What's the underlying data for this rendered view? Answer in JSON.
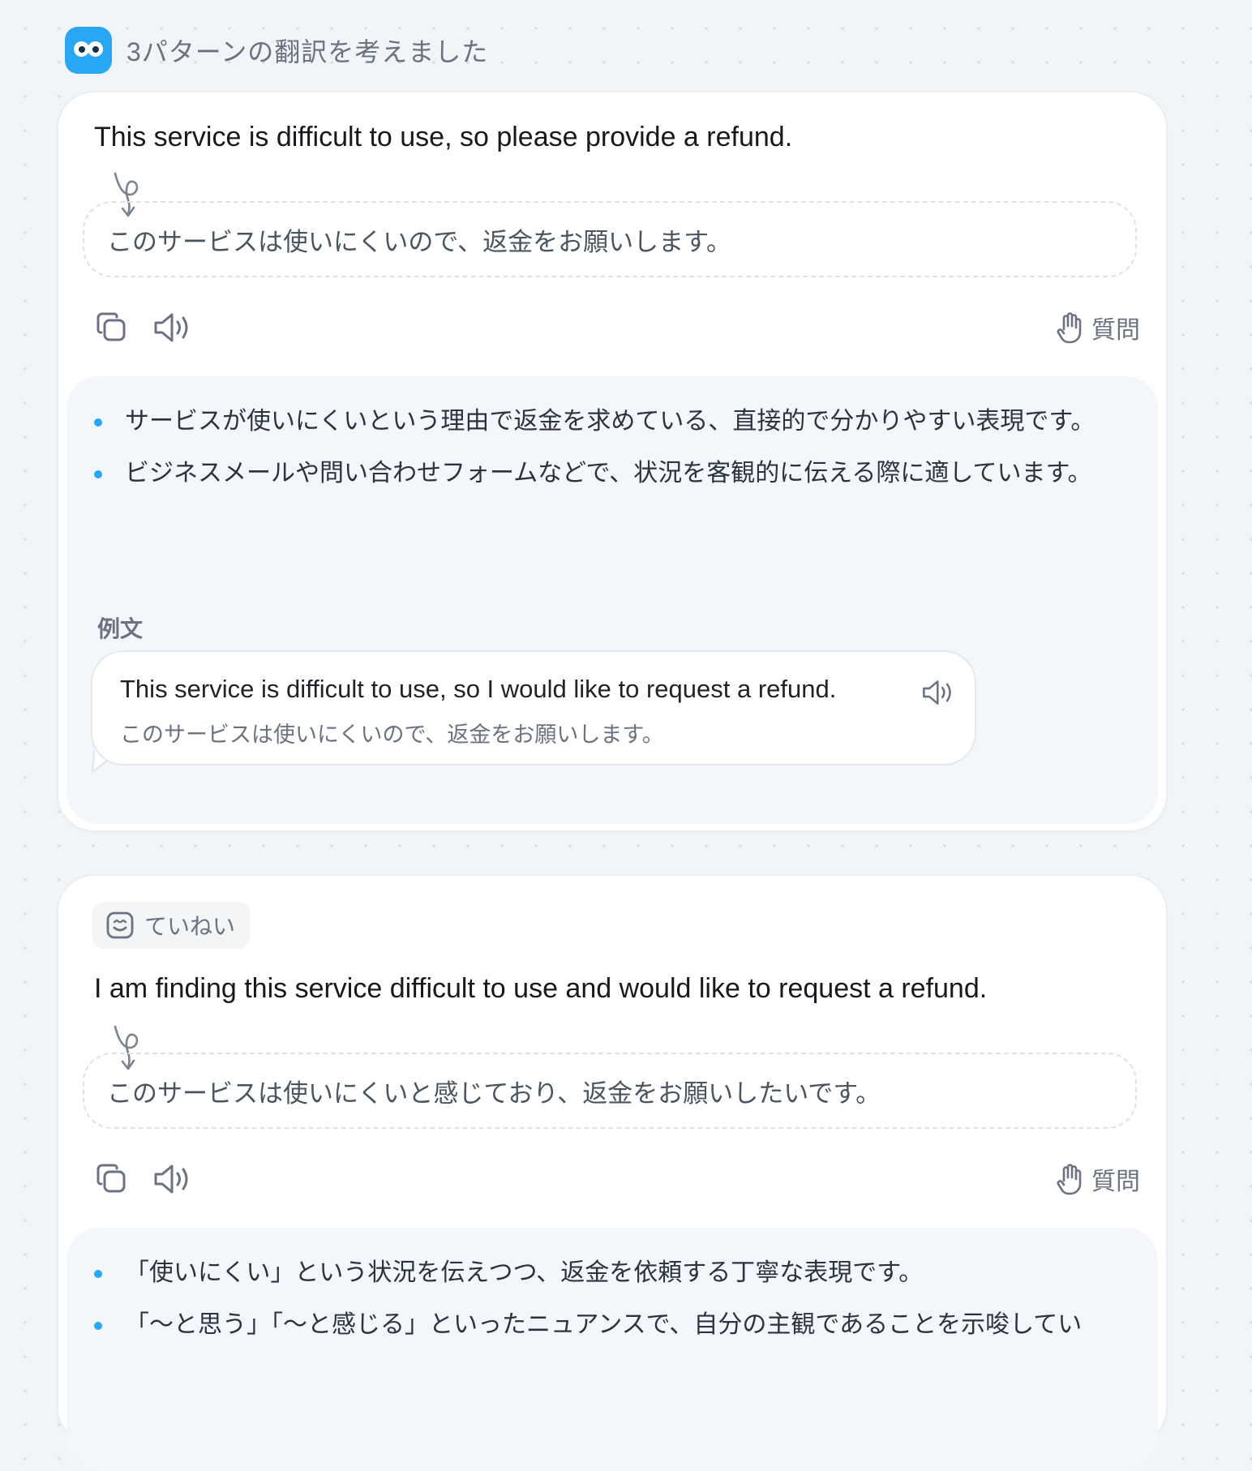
{
  "header": {
    "title": "3パターンの翻訳を考えました"
  },
  "cards": [
    {
      "english": "This service is difficult to use, so please provide a refund.",
      "japanese": "このサービスは使いにくいので、返金をお願いします。",
      "ask_label": "質問",
      "explanations": [
        "サービスが使いにくいという理由で返金を求めている、直接的で分かりやすい表現です。",
        "ビジネスメールや問い合わせフォームなどで、状況を客観的に伝える際に適しています。"
      ],
      "example": {
        "label": "例文",
        "english": "This service is difficult to use, so I would like to request a refund.",
        "japanese": "このサービスは使いにくいので、返金をお願いします。"
      }
    },
    {
      "tone": "ていねい",
      "english": "I am finding this service difficult to use and would like to request a refund.",
      "japanese": "このサービスは使いにくいと感じており、返金をお願いしたいです。",
      "ask_label": "質問",
      "explanations": [
        "「使いにくい」という状況を伝えつつ、返金を依頼する丁寧な表現です。",
        "「〜と思う」「〜と感じる」といったニュアンスで、自分の主観であることを示唆してい"
      ]
    }
  ],
  "icons": {
    "avatar": "bot-avatar-icon",
    "copy": "copy-icon",
    "speak": "speaker-icon",
    "ask": "raised-hand-icon",
    "translation_link": "loop-arrow-icon",
    "tone": "smile-face-icon"
  },
  "colors": {
    "accent": "#2aa7f4",
    "background": "#f1f5f8",
    "explain_bg": "#f3f7fc",
    "muted_text": "#6b7280"
  }
}
